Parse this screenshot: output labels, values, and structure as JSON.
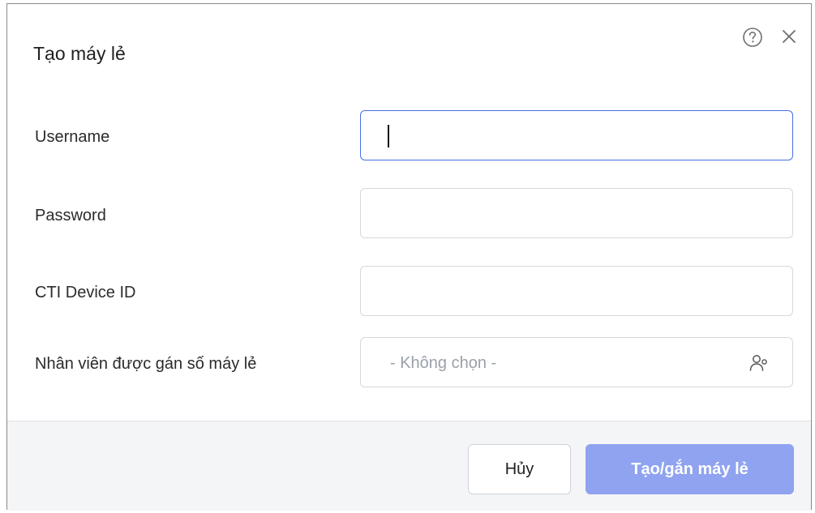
{
  "dialog": {
    "title": "Tạo máy lẻ",
    "help_icon": "question-circle-icon",
    "close_icon": "close-icon"
  },
  "form": {
    "username": {
      "label": "Username",
      "value": ""
    },
    "password": {
      "label": "Password",
      "value": ""
    },
    "cti_device_id": {
      "label": "CTI Device ID",
      "value": ""
    },
    "assigned_employee": {
      "label": "Nhân viên được gán số máy lẻ",
      "placeholder": "- Không chọn -",
      "icon": "user-group-icon"
    }
  },
  "footer": {
    "cancel_label": "Hủy",
    "submit_label": "Tạo/gắn máy lẻ"
  },
  "colors": {
    "accent": "#4a6ee0",
    "submit_disabled": "#8fa3f0",
    "footer_bg": "#f4f5f7"
  }
}
